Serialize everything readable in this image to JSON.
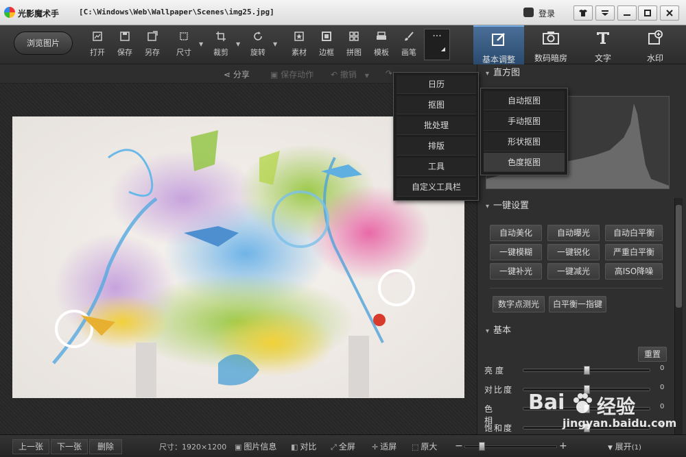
{
  "titlebar": {
    "app_name": "光影魔术手",
    "file_path": "[C:\\Windows\\Web\\Wallpaper\\Scenes\\img25.jpg]",
    "login_label": "登录",
    "buttons": [
      "skin",
      "menu",
      "minimize",
      "maximize",
      "close"
    ]
  },
  "toolbar": {
    "browse_label": "浏览图片",
    "tools": [
      {
        "label": "打开",
        "icon": "open-icon"
      },
      {
        "label": "保存",
        "icon": "save-icon"
      },
      {
        "label": "另存",
        "icon": "save-as-icon"
      },
      {
        "label": "尺寸",
        "icon": "resize-icon"
      },
      {
        "label": "裁剪",
        "icon": "crop-icon"
      },
      {
        "label": "旋转",
        "icon": "rotate-icon"
      },
      {
        "label": "素材",
        "icon": "material-icon"
      },
      {
        "label": "边框",
        "icon": "border-icon"
      },
      {
        "label": "拼图",
        "icon": "collage-icon"
      },
      {
        "label": "模板",
        "icon": "template-icon"
      },
      {
        "label": "画笔",
        "icon": "brush-icon"
      }
    ],
    "more_label": "···",
    "right_tabs": [
      {
        "label": "基本调整",
        "icon": "basic-adjust-icon",
        "active": true
      },
      {
        "label": "数码暗房",
        "icon": "darkroom-icon",
        "active": false
      },
      {
        "label": "文字",
        "icon": "text-icon",
        "active": false
      },
      {
        "label": "水印",
        "icon": "watermark-icon",
        "active": false
      }
    ]
  },
  "subbar": {
    "share": "分享",
    "save_action": "保存动作",
    "undo": "撤销"
  },
  "more_menu": {
    "items": [
      "日历",
      "抠图",
      "批处理",
      "排版",
      "工具",
      "自定义工具栏"
    ]
  },
  "cutout_menu": {
    "items": [
      "自动抠图",
      "手动抠图",
      "形状抠图",
      "色度抠图"
    ],
    "hovered_index": 3
  },
  "panel": {
    "histogram_title": "直方图",
    "one_click_title": "一键设置",
    "one_click_buttons": [
      "自动美化",
      "自动曝光",
      "自动白平衡",
      "一键模糊",
      "一键锐化",
      "严重白平衡",
      "一键补光",
      "一键减光",
      "高ISO降噪"
    ],
    "extra_buttons": [
      "数字点测光",
      "白平衡一指键"
    ],
    "basic_title": "基本",
    "reset_label": "重置",
    "sliders": [
      {
        "label": "亮度",
        "value": "0",
        "level": 0.5
      },
      {
        "label": "对比度",
        "value": "0",
        "level": 0.5
      },
      {
        "label": "色相",
        "value": "0",
        "level": 0.5
      },
      {
        "label": "饱和度",
        "value": "0",
        "level": 0.5
      }
    ]
  },
  "statusbar": {
    "prev": "上一张",
    "next": "下一张",
    "delete": "删除",
    "size_text": "尺寸：1920×1200",
    "items": [
      {
        "label": "图片信息",
        "icon": "image-info-icon"
      },
      {
        "label": "对比",
        "icon": "compare-icon"
      },
      {
        "label": "全屏",
        "icon": "fullscreen-icon"
      },
      {
        "label": "适屏",
        "icon": "fit-screen-icon"
      },
      {
        "label": "原大",
        "icon": "original-size-icon"
      }
    ],
    "zoom_minus": "−",
    "zoom_plus": "+",
    "expand_label": "展开",
    "expand_count": "(1)"
  },
  "watermark": {
    "brand_left": "Bai",
    "brand_right": "经验",
    "url": "jingyan.baidu.com"
  }
}
